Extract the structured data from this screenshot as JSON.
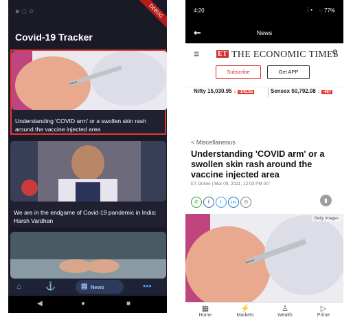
{
  "left_app": {
    "title": "Covid-19 Tracker",
    "debug_banner": "DEBUG",
    "status_icons": "▪ ○ ⊙",
    "articles": [
      {
        "caption": "Understanding 'COVID arm' or a swollen skin rash around the vaccine injected area"
      },
      {
        "caption": "We are in the endgame of Covid-19 pandemic in India: Harsh Vardhan"
      },
      {
        "caption": ""
      }
    ],
    "nav": {
      "active_label": "News"
    },
    "accent": "#3ea1ff"
  },
  "right_app": {
    "status": {
      "time": "4:20",
      "battery": "77%"
    },
    "appbar": {
      "title": "News"
    },
    "header": {
      "logo_mark": "ET",
      "logo_text": "THE ECONOMIC TIMES",
      "subscribe_label": "Subscribe",
      "get_app_label": "Get APP"
    },
    "ticker": {
      "nifty": "Nifty 15,030.95",
      "nifty_change": "-143.85",
      "sensex": "Sensex 50,792.08",
      "sensex_change": "-487"
    },
    "article": {
      "breadcrumb": "< Miscellaneous",
      "headline": "Understanding 'COVID arm' or a swollen skin rash around the vaccine injected area",
      "meta": "ET Online | Mar 09, 2021, 12:03 PM IST",
      "image_credit": "Getty Images"
    },
    "bottom_nav": [
      "Home",
      "Markets",
      "Wealth",
      "Prime"
    ]
  }
}
